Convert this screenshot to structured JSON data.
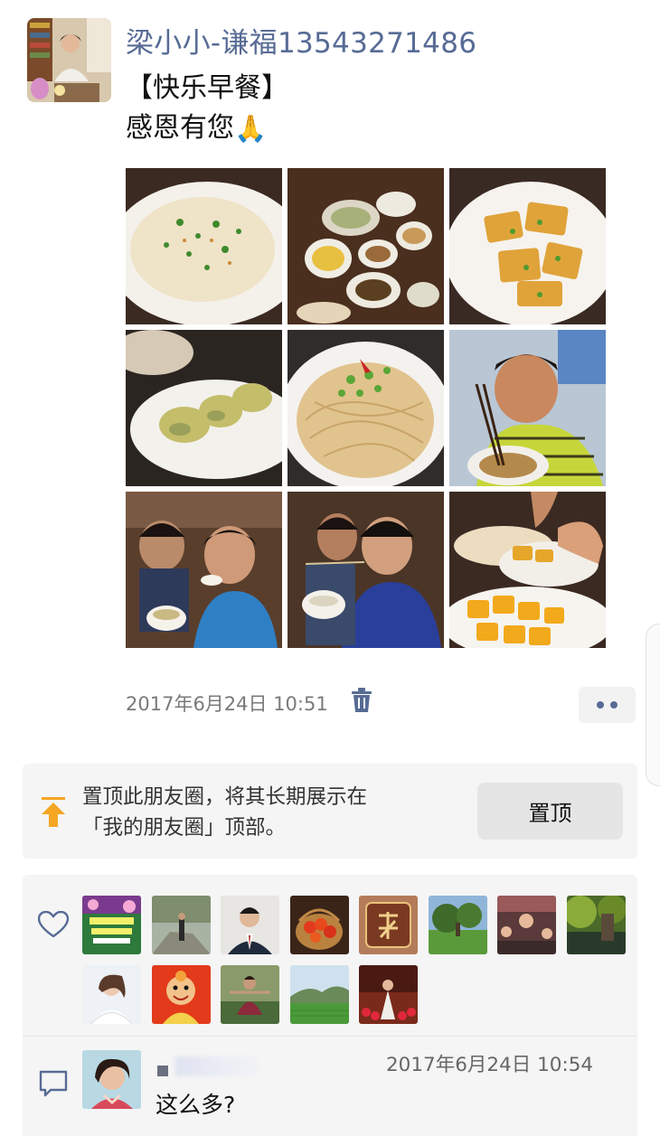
{
  "post": {
    "author": "梁小小-谦福13543271486",
    "text_line1": "【快乐早餐】",
    "text_line2": "感恩有您",
    "text_emoji": "🙏",
    "photo_count": 9,
    "timestamp": "2017年6月24日 10:51"
  },
  "pin_panel": {
    "line1": "置顶此朋友圈，将其长期展示在",
    "line2": "「我的朋友圈」顶部。",
    "button_label": "置顶"
  },
  "likes": {
    "count": 13
  },
  "comment": {
    "time": "2017年6月24日 10:54",
    "text": "这么多?"
  },
  "colors": {
    "link_blue": "#576b95",
    "panel_bg": "#f5f5f5",
    "pin_icon": "#f5a623"
  },
  "icons": {
    "delete": "trash-icon",
    "like": "heart-outline-icon",
    "comment": "comment-bubble-icon",
    "pin": "pin-to-top-icon"
  }
}
